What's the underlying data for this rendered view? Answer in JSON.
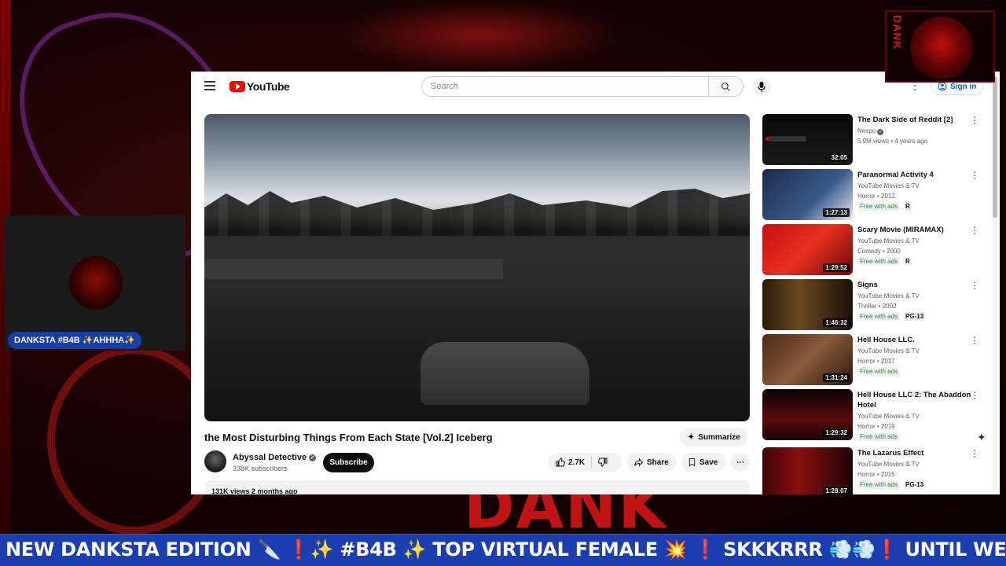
{
  "youtube": {
    "logo_text": "YouTube",
    "search_placeholder": "Search",
    "signin_label": "Sign in"
  },
  "video": {
    "title": "the Most Disturbing Things From Each State [Vol.2] Iceberg",
    "summarize_label": "Summarize",
    "channel_name": "Abyssal Detective",
    "subscribers": "338K subscribers",
    "subscribe_label": "Subscribe",
    "likes": "2.7K",
    "share_label": "Share",
    "save_label": "Save",
    "views_date": "131K views  2 months ago"
  },
  "recommendations": [
    {
      "title": "The Dark Side of Reddit [2]",
      "channel": "Nexpo",
      "meta": "5.9M views • 4 years ago",
      "duration": "32:05",
      "free": "",
      "rating": "",
      "verified": true
    },
    {
      "title": "Paranormal Activity 4",
      "channel": "YouTube Movies & TV",
      "meta": "Horror • 2012",
      "duration": "1:27:13",
      "free": "Free with ads",
      "rating": "R"
    },
    {
      "title": "Scary Movie (MIRAMAX)",
      "channel": "YouTube Movies & TV",
      "meta": "Comedy • 2000",
      "duration": "1:29:52",
      "free": "Free with ads",
      "rating": "R"
    },
    {
      "title": "Signs",
      "channel": "YouTube Movies & TV",
      "meta": "Thriller • 2002",
      "duration": "1:46:32",
      "free": "Free with ads",
      "rating": "PG-13"
    },
    {
      "title": "Hell House LLC.",
      "channel": "YouTube Movies & TV",
      "meta": "Horror • 2017",
      "duration": "1:31:24",
      "free": "Free with ads",
      "rating": ""
    },
    {
      "title": "Hell House LLC 2: The Abaddon Hotel",
      "channel": "YouTube Movies & TV",
      "meta": "Horror • 2019",
      "duration": "1:29:32",
      "free": "Free with ads",
      "rating": ""
    },
    {
      "title": "The Lazarus Effect",
      "channel": "YouTube Movies & TV",
      "meta": "Horror • 2015",
      "duration": "1:28:07",
      "free": "Free with ads",
      "rating": "PG-13"
    }
  ],
  "overlay": {
    "cam_label": "DANKSTA #B4B ✨AHHHA✨",
    "corner_logo_text": "DANK",
    "background_text": "DANK",
    "ticker": "NEW DANKSTA EDITION 🔪 ❗✨ #B4B ✨ TOP VIRTUAL FEMALE 💥 ❗ SKKKRRR 💨💨❗ UNTIL WE RE"
  },
  "colors": {
    "ticker_bg": "#1b3fb0",
    "youtube_red": "#ff0000",
    "free_with_ads": "#1e8e3e",
    "signin_blue": "#065fd4"
  },
  "icons": {
    "menu": "hamburger-icon",
    "search": "search-icon",
    "mic": "mic-icon",
    "like": "thumbs-up-icon",
    "dislike": "thumbs-down-icon",
    "share": "share-arrow-icon",
    "save": "bookmark-icon",
    "summarize": "sparkle-icon"
  }
}
